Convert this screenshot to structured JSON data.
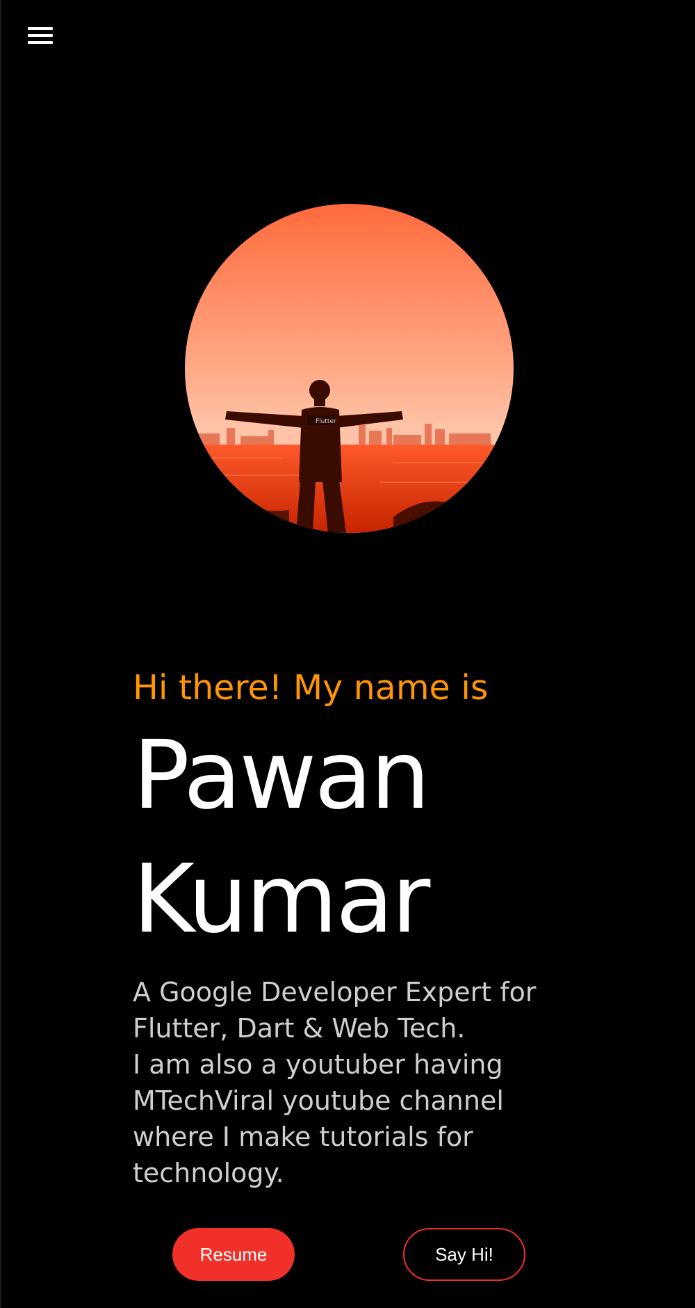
{
  "header": {
    "menu_icon": "hamburger-menu-icon"
  },
  "profile": {
    "photo": "profile-photo",
    "greeting": "Hi there! My name is",
    "first_name": "Pawan",
    "last_name": "Kumar",
    "bio_lines": [
      "A Google Developer Expert for",
      "Flutter, Dart & Web Tech.",
      "I am also a youtuber having",
      "MTechViral youtube channel",
      "where I make tutorials for",
      "technology."
    ],
    "shirt_text": "Flutter"
  },
  "actions": {
    "resume_label": "Resume",
    "say_hi_label": "Say Hi!"
  },
  "colors": {
    "background": "#000000",
    "accent_orange": "#ff9500",
    "accent_red": "#f2302a",
    "bio_text": "#cfcfcf"
  }
}
